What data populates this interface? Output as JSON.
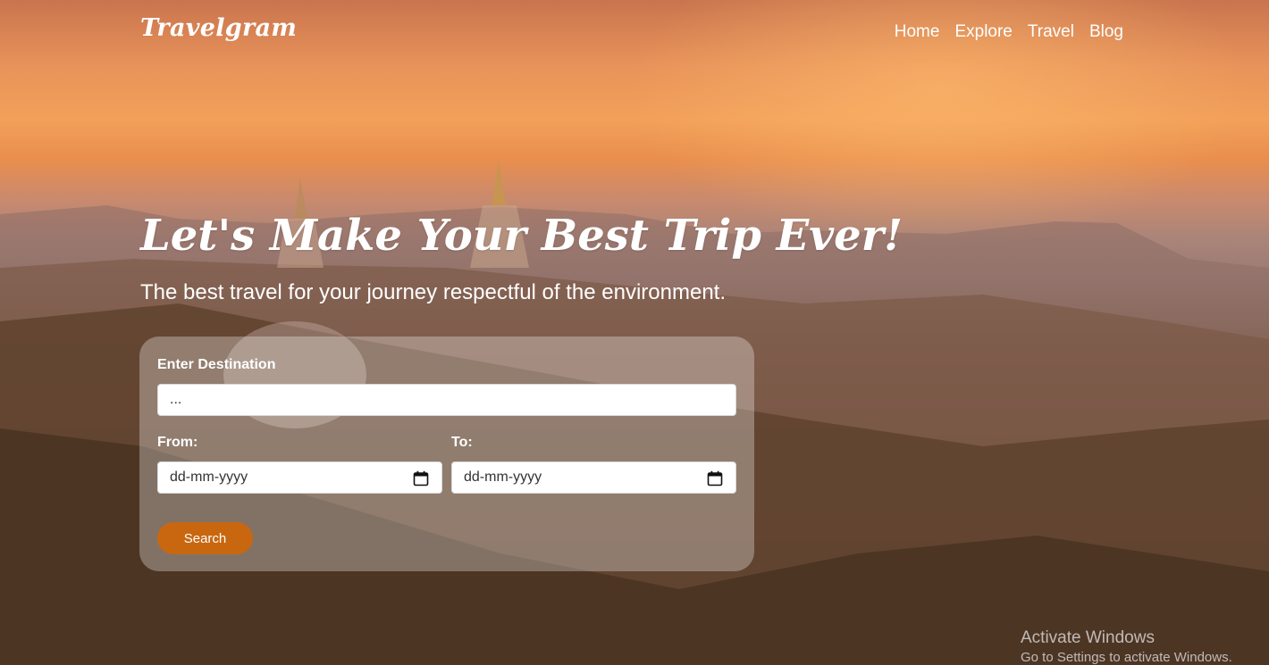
{
  "header": {
    "logo": "Travelgram",
    "nav": [
      "Home",
      "Explore",
      "Travel",
      "Blog"
    ]
  },
  "hero": {
    "title": "Let's Make Your Best Trip Ever!",
    "subtitle": "The best travel for your journey respectful of the environment."
  },
  "form": {
    "destination_label": "Enter Destination",
    "destination_placeholder": "...",
    "from_label": "From:",
    "from_placeholder": "dd-mm-yyyy",
    "to_label": "To:",
    "to_placeholder": "dd-mm-yyyy",
    "search_label": "Search"
  },
  "watermark": {
    "title": "Activate Windows",
    "subtitle": "Go to Settings to activate Windows."
  },
  "colors": {
    "accent": "#c8670f",
    "text": "#ffffff"
  },
  "icons": {
    "date": "calendar-icon"
  }
}
